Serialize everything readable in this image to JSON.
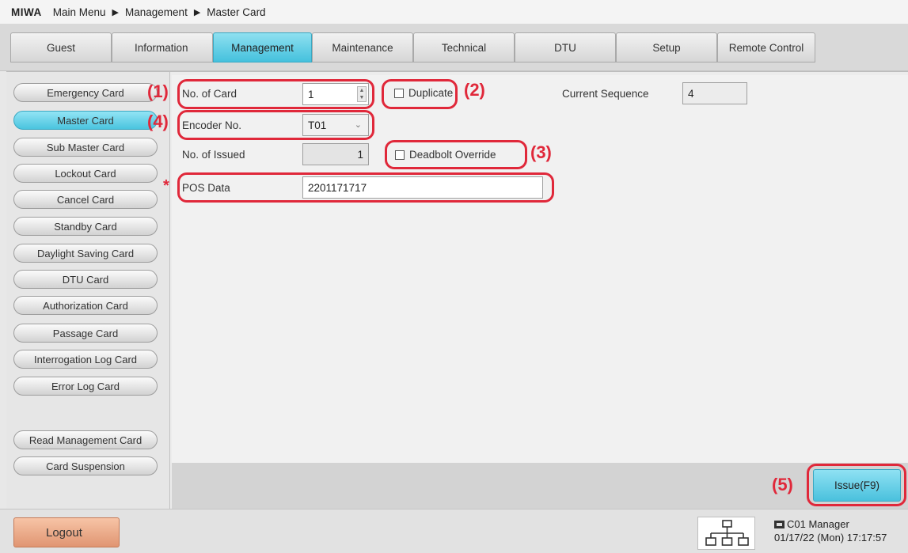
{
  "breadcrumb": {
    "brand": "MIWA",
    "items": [
      "Main Menu",
      "Management",
      "Master Card"
    ],
    "separator": "▶"
  },
  "tabs": [
    "Guest",
    "Information",
    "Management",
    "Maintenance",
    "Technical",
    "DTU",
    "Setup",
    "Remote Control"
  ],
  "active_tab": "Management",
  "sidebar": {
    "items": [
      "Emergency Card",
      "Master Card",
      "Sub Master Card",
      "Lockout Card",
      "Cancel Card",
      "Standby Card",
      "Daylight Saving Card",
      "DTU Card",
      "Authorization Card",
      "Passage Card",
      "Interrogation Log Card",
      "Error Log Card",
      "Read Management Card",
      "Card Suspension"
    ],
    "active": "Master Card"
  },
  "form": {
    "no_of_card_label": "No. of Card",
    "no_of_card_value": "1",
    "duplicate_label": "Duplicate",
    "current_sequence_label": "Current Sequence",
    "current_sequence_value": "4",
    "encoder_label": "Encoder No.",
    "encoder_value": "T01",
    "no_of_issued_label": "No. of Issued",
    "no_of_issued_value": "1",
    "deadbolt_label": "Deadbolt Override",
    "pos_label": "POS Data",
    "pos_value": "2201171717"
  },
  "annotations": {
    "n1": "(1)",
    "n2": "(2)",
    "n3": "(3)",
    "n4": "(4)",
    "n5": "(5)",
    "star": "*"
  },
  "issue_button": "Issue(F9)",
  "logout_button": "Logout",
  "status": {
    "terminal": "C01 Manager",
    "datetime": "01/17/22 (Mon) 17:17:57"
  },
  "colors": {
    "accent": "#4ac1dd",
    "annotation": "#e0283a",
    "logout": "#e09572"
  },
  "icons": {
    "network": "network-icon",
    "terminal": "terminal-icon"
  }
}
